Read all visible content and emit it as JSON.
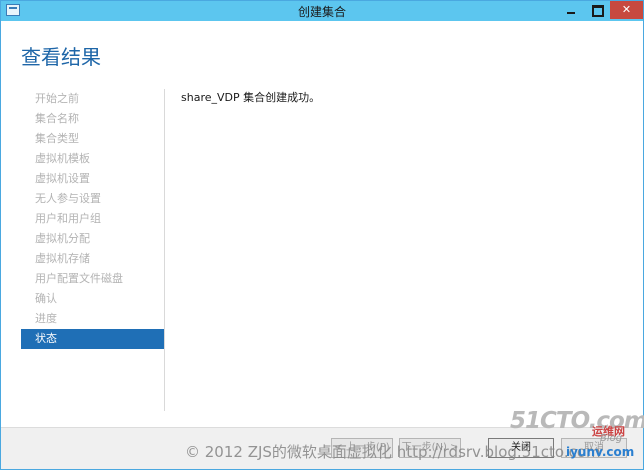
{
  "window": {
    "title": "创建集合",
    "minimize_glyph": "",
    "maximize_glyph": "",
    "close_glyph": "✕"
  },
  "page": {
    "title": "查看结果",
    "status_message": "share_VDP 集合创建成功。"
  },
  "nav": {
    "items": [
      {
        "label": "开始之前"
      },
      {
        "label": "集合名称"
      },
      {
        "label": "集合类型"
      },
      {
        "label": "虚拟机模板"
      },
      {
        "label": "虚拟机设置"
      },
      {
        "label": "无人参与设置"
      },
      {
        "label": "用户和用户组"
      },
      {
        "label": "虚拟机分配"
      },
      {
        "label": "虚拟机存储"
      },
      {
        "label": "用户配置文件磁盘"
      },
      {
        "label": "确认"
      },
      {
        "label": "进度"
      },
      {
        "label": "状态"
      }
    ],
    "active_index": 12
  },
  "footer": {
    "prev_label": "< 上一步(P)",
    "next_label": "下一步(N) >",
    "close_label": "关闭",
    "cancel_label": "取消"
  },
  "watermark": {
    "copyright": "© 2012 ZJS的微软桌面虚拟化 http://rdsrv.blog.51cto.com",
    "brand": "51CTO.com",
    "blog_label": "Blog",
    "site": "运维网",
    "url": "iyunv.com"
  },
  "colors": {
    "titlebar": "#5cc6ef",
    "accent": "#1f6fb6",
    "close_button": "#c7493f"
  }
}
